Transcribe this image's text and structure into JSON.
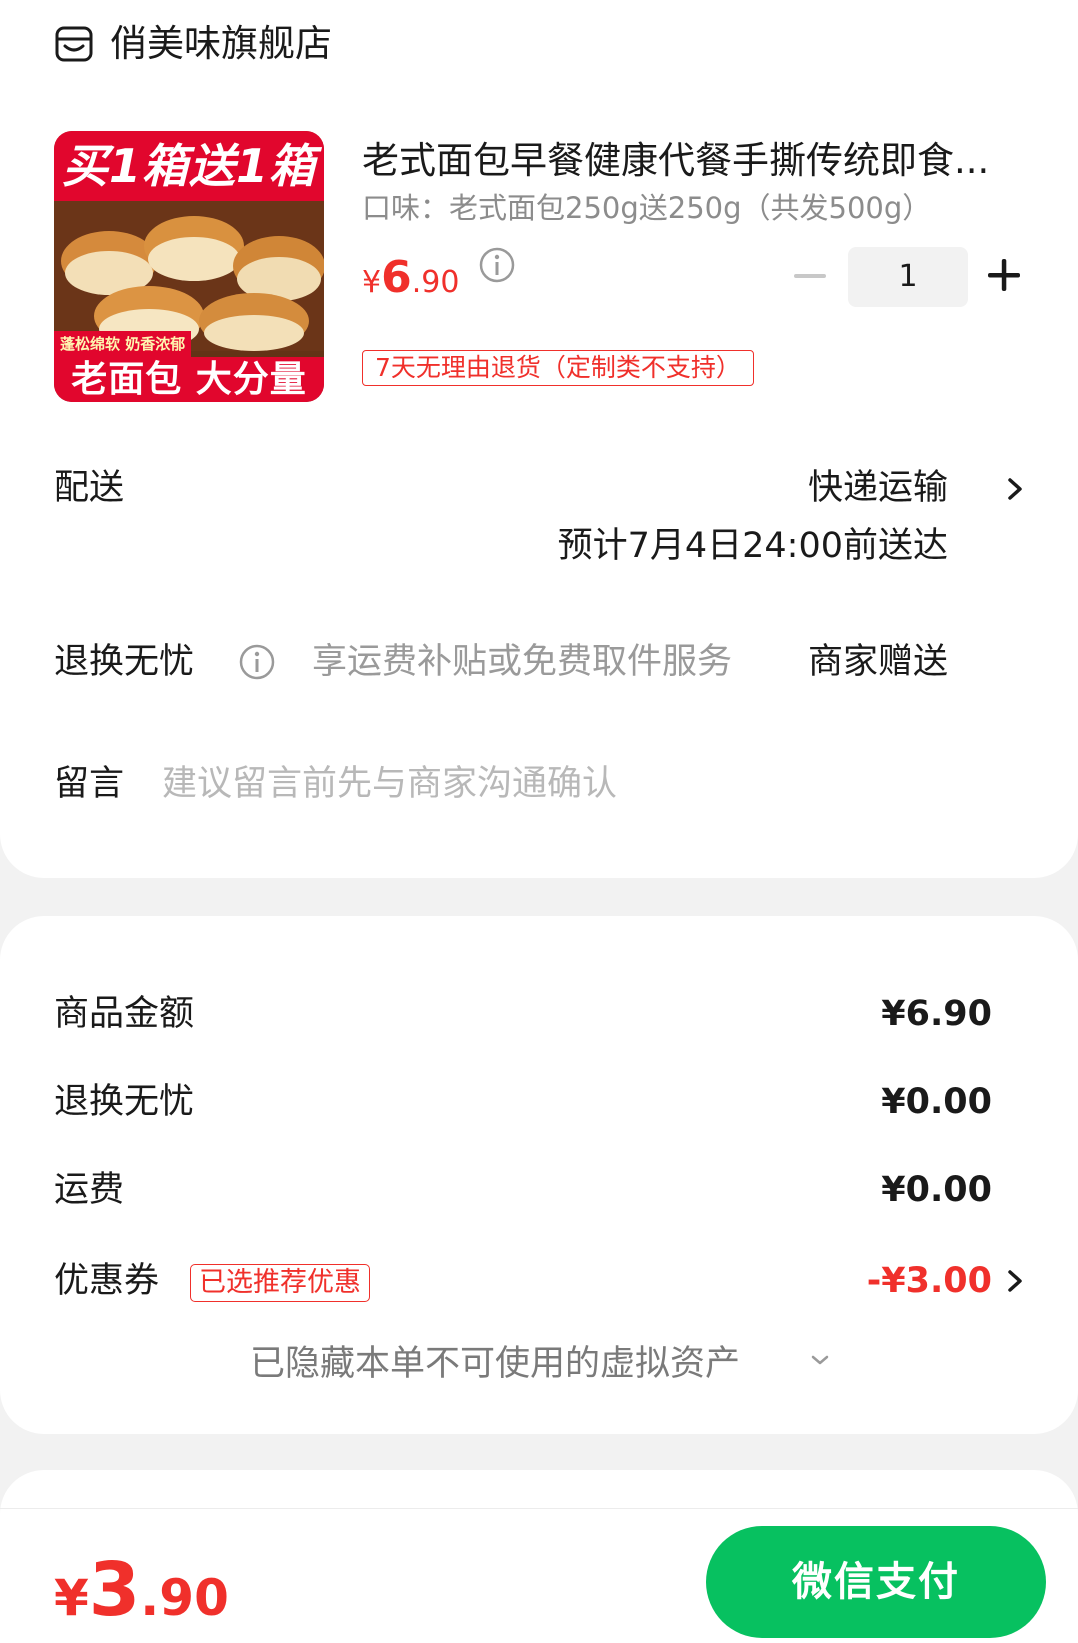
{
  "store": {
    "name": "俏美味旗舰店"
  },
  "product": {
    "image_top_text": "买1箱送1箱",
    "image_tag": "蓬松绵软 奶香浓郁",
    "image_bottom_text": "老面包 大分量",
    "title": "老式面包早餐健康代餐手撕传统即食...",
    "spec": "口味：老式面包250g送250g（共发500g）",
    "price_symbol": "¥",
    "price_int": "6",
    "price_dec": ".90",
    "quantity": "1",
    "return_policy": "7天无理由退货（定制类不支持）"
  },
  "delivery": {
    "label": "配送",
    "method": "快递运输",
    "eta": "预计7月4日24:00前送达"
  },
  "worry_free": {
    "label": "退换无忧",
    "description": "享运费补贴或免费取件服务",
    "value": "商家赠送"
  },
  "message": {
    "label": "留言",
    "placeholder": "建议留言前先与商家沟通确认"
  },
  "summary": {
    "items": [
      {
        "label": "商品金额",
        "value": "¥6.90"
      },
      {
        "label": "退换无忧",
        "value": "¥0.00"
      },
      {
        "label": "运费",
        "value": "¥0.00"
      }
    ],
    "coupon": {
      "label": "优惠券",
      "badge": "已选推荐优惠",
      "value": "-¥3.00"
    },
    "hidden_assets": "已隐藏本单不可使用的虚拟资产"
  },
  "footer": {
    "total_symbol": "¥",
    "total_int": "3",
    "total_dec": ".90",
    "pay_label": "微信支付"
  },
  "colors": {
    "accent_red": "#f0302b",
    "pay_green": "#07c160",
    "background": "#f2f2f2"
  },
  "icons": [
    "store-icon",
    "info-icon",
    "minus-icon",
    "plus-icon",
    "chevron-right-icon",
    "chevron-down-icon"
  ]
}
